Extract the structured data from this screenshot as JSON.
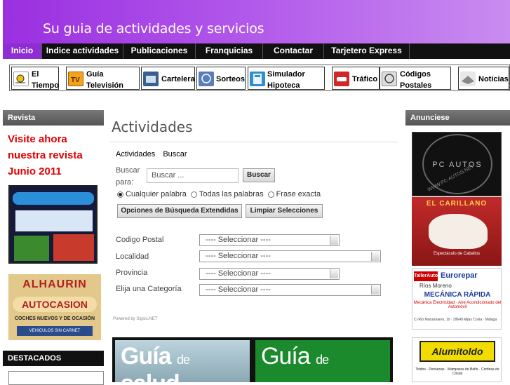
{
  "header": {
    "slogan": "Su guia de actividades y servicios"
  },
  "nav": {
    "tabs": [
      "Inicio",
      "Indice actividades",
      "Publicaciones",
      "Franquicias",
      "Contactar",
      "Tarjetero Express"
    ]
  },
  "iconbar": {
    "items": [
      {
        "label": "El Tiempo",
        "icon": "weather-icon"
      },
      {
        "label": "Guía Televisión",
        "icon": "tv-icon"
      },
      {
        "label": "Cartelera",
        "icon": "cinema-icon"
      },
      {
        "label": "Sorteos",
        "icon": "lottery-icon"
      },
      {
        "label": "Simulador Hipoteca",
        "icon": "calculator-icon"
      },
      {
        "label": "Tráfico",
        "icon": "car-icon"
      },
      {
        "label": "Códigos Postales",
        "icon": "post-icon"
      },
      {
        "label": "Noticias",
        "icon": "news-icon"
      }
    ]
  },
  "left": {
    "revista_header": "Revista",
    "revista_text": [
      "Visite ahora",
      "nuestra revista",
      "Junio 2011"
    ],
    "autocasion": {
      "title": "ALHAURIN",
      "subtitle": "AUTOCASION",
      "line": "COCHES NUEVOS Y DE OCASIÓN",
      "small": "VEHÍCULOS SIN CARNET"
    },
    "destacados_header": "DESTACADOS"
  },
  "main": {
    "title": "Actividades",
    "breadcrumb": [
      "Actividades",
      "Buscar"
    ],
    "search_label": "Buscar para:",
    "search_placeholder": "Buscar ...",
    "search_button": "Buscar",
    "radios": [
      {
        "label": "Cualquier palabra",
        "checked": true
      },
      {
        "label": "Todas las palabras",
        "checked": false
      },
      {
        "label": "Frase exacta",
        "checked": false
      }
    ],
    "advanced_button": "Opciones de Búsqueda Extendidas",
    "clear_button": "Limpiar Selecciones",
    "filters": [
      {
        "label": "Codigo Postal",
        "value": "---- Seleccionar ----"
      },
      {
        "label": "Localidad",
        "value": "---- Seleccionar ----"
      },
      {
        "label": "Provincia",
        "value": "---- Seleccionar ----"
      },
      {
        "label": "Elija una Categoría",
        "value": "---- Seleccionar ----"
      }
    ],
    "powered_by": "Powered by Sigsiu.NET",
    "promo": {
      "left": {
        "title": "Guía",
        "connector": "de",
        "topic": "salud"
      },
      "right": {
        "title": "Guía",
        "connector": "de"
      }
    }
  },
  "right": {
    "header": "Anunciese",
    "ads": {
      "pc_autos": {
        "name": "PC AUTOS",
        "url": "WWW.PC-AUTOS.NET"
      },
      "circus": {
        "title": "EL CARILLANO",
        "small": "Espectáculo de Caballos"
      },
      "eurorepar": {
        "brand_left": "TallerAuto",
        "brand_right": "Eurorepar",
        "owner": "Ríos Moreno",
        "title": "MECÁNICA RÁPIDA",
        "sub": "Mecánica Electricidad · Aire Acondicionado del Automóvil",
        "footer": "C/ Río Manzanares, 10 · 29649 Mijas Costa · Málaga"
      },
      "alumitoldo": {
        "name": "Alumitoldo",
        "sub": "Toldos · Persianas · Mamparas de Baño · Cortinas de Cristal"
      }
    }
  },
  "colors": {
    "header_start": "#9a2fe0",
    "nav_bg": "#111111",
    "nav_active": "#8d2dd2",
    "revista_text": "#e00000"
  }
}
